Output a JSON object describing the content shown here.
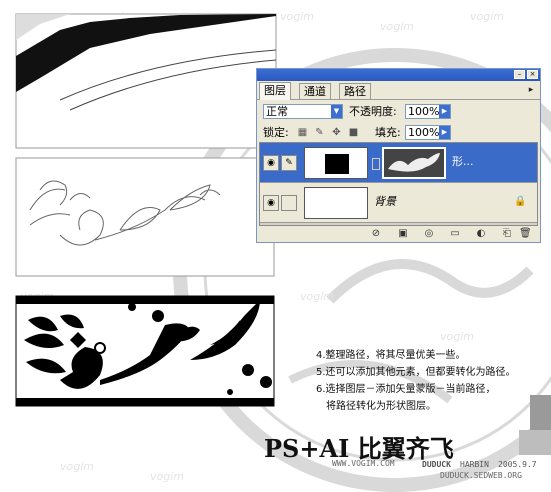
{
  "panel": {
    "tabs": [
      {
        "label": "图层",
        "active": true
      },
      {
        "label": "通道",
        "active": false
      },
      {
        "label": "路径",
        "active": false
      }
    ],
    "blend_mode": "正常",
    "opacity_label": "不透明度:",
    "opacity_value": "100%",
    "lock_label": "锁定:",
    "fill_label": "填充:",
    "fill_value": "100%",
    "layers": [
      {
        "name": "形...",
        "selected": true
      },
      {
        "name": "背景",
        "selected": false
      }
    ]
  },
  "instructions": [
    "4.整理路径，将其尽量优美一些。",
    "5.还可以添加其他元素，但都要转化为路径。",
    "6.选择图层－添加矢量蒙版－当前路径，",
    "将路径转化为形状图层。"
  ],
  "title": "PS+AI 比翼齐飞",
  "credits": {
    "left": "WWW.VOGIM.COM",
    "author": "DUDUCK",
    "city": "HARBIN",
    "date": "2005.9.7",
    "email": "DUDUCK.SEDWEB.ORG"
  },
  "watermark": "vogim",
  "colors": {
    "selection": "#3a6bc9",
    "panel": "#ece9d8",
    "titlebar": "#2a58bd"
  }
}
